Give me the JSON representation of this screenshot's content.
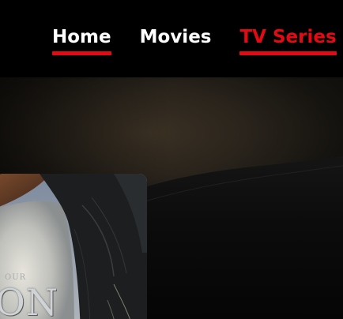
{
  "nav": {
    "items": [
      {
        "label": "Home",
        "active": false
      },
      {
        "label": "Movies",
        "active": false
      },
      {
        "label": "TV Series",
        "active": true
      }
    ]
  },
  "poster": {
    "kicker": "OUR",
    "title": "ON"
  },
  "colors": {
    "accent": "#e50914",
    "header_bg": "#000000",
    "nav_text": "#ffffff"
  }
}
